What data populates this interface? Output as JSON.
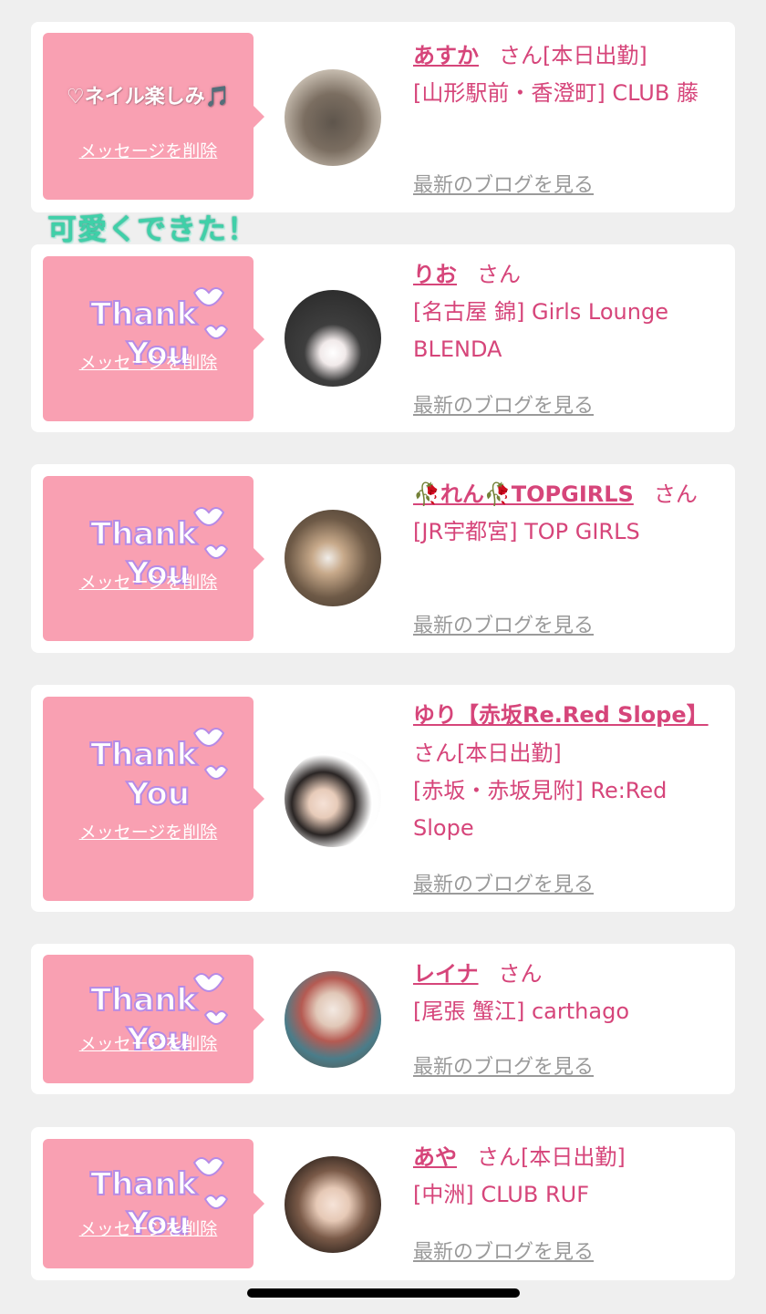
{
  "colors": {
    "bubble": "#f9a0b2",
    "accent": "#d6457a",
    "link_gray": "#9a9a9a",
    "background": "#efefef"
  },
  "floating_sticker_text": "可愛くできた！",
  "items": [
    {
      "message": "♡ネイル楽しみ🎵",
      "delete_label": "メッセージを削除",
      "name": "あすか",
      "honorific": "さん",
      "status": "[本日出勤]",
      "shop": "[山形駅前・香澄町] CLUB 藤",
      "blog_label": "最新のブログを見る"
    },
    {
      "message": "",
      "sticker": "Thank You",
      "delete_label": "メッセージを削除",
      "name": "りお",
      "honorific": "さん",
      "status": "",
      "shop": "[名古屋 錦] Girls Lounge BLENDA",
      "blog_label": "最新のブログを見る"
    },
    {
      "message": "",
      "sticker": "Thank You",
      "delete_label": "メッセージを削除",
      "name": "🥀れん🥀TOPGIRLS",
      "honorific": "さん",
      "status": "",
      "shop": "[JR宇都宮] TOP GIRLS",
      "blog_label": "最新のブログを見る"
    },
    {
      "message": "",
      "sticker": "Thank You",
      "delete_label": "メッセージを削除",
      "name": "ゆり【赤坂Re.Red Slope】",
      "honorific": "さん",
      "status": "[本日出勤]",
      "shop": "[赤坂・赤坂見附] Re:Red Slope",
      "blog_label": "最新のブログを見る"
    },
    {
      "message": "",
      "sticker": "Thank You",
      "delete_label": "メッセージを削除",
      "name": "レイナ",
      "honorific": "さん",
      "status": "",
      "shop": "[尾張 蟹江] carthago",
      "blog_label": "最新のブログを見る"
    },
    {
      "message": "",
      "sticker": "Thank You",
      "delete_label": "メッセージを削除",
      "name": "あや",
      "honorific": "さん",
      "status": "[本日出勤]",
      "shop": "[中洲] CLUB RUF",
      "blog_label": "最新のブログを見る"
    }
  ]
}
